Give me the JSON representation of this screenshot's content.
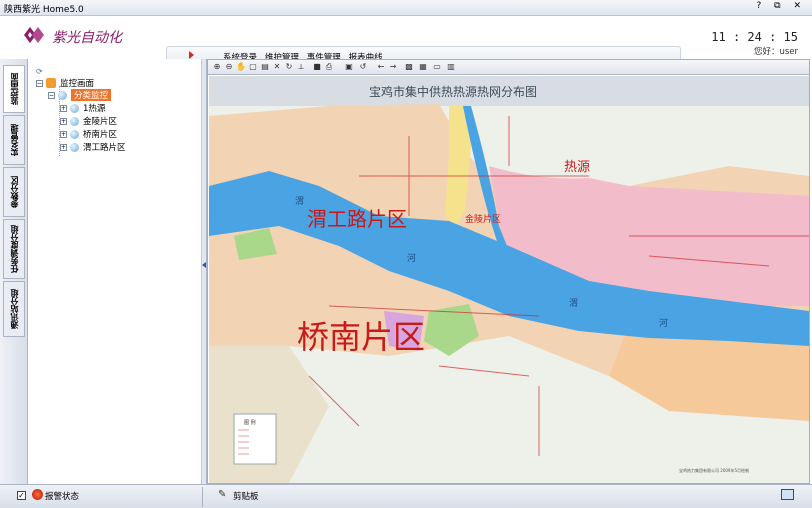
{
  "window": {
    "title": "陕西紫光 Home5.0",
    "controls": "? ⧉ ✕"
  },
  "header": {
    "logo_text": "紫光自动化",
    "menu": [
      "系统登录",
      "维护管理",
      "事件管理",
      "报表曲线"
    ],
    "clock": "11 : 24 : 15",
    "user": "您好：user"
  },
  "side_tabs": [
    "监控画面",
    "实名管理",
    "参数分区",
    "任务调度分组",
    "通讯站分组"
  ],
  "tree": {
    "root": "监控画面",
    "selected": "分类监控",
    "items": [
      "1热源",
      "金陵片区",
      "桥南片区",
      "渭工路片区"
    ]
  },
  "map": {
    "title": "宝鸡市集中供热热源热网分布图",
    "labels": {
      "heat_source": "热源",
      "weigong": "渭工路片区",
      "qiaonan": "桥南片区",
      "jinling": "金陵片区",
      "river1": "渭",
      "river2": "河",
      "river3": "渭",
      "river4": "河"
    },
    "legend_title": "图 例",
    "footer_note": "宝鸡热力集团有限公司 2009年5月绘制"
  },
  "status": {
    "alarm": "报警状态",
    "clipboard": "剪贴板"
  },
  "colors": {
    "accent": "#f0742a",
    "river": "#4aa3e3",
    "pink": "#f3bccb",
    "orange": "#f6c99a",
    "peach": "#f2d3b3",
    "green": "#a9d88b"
  }
}
